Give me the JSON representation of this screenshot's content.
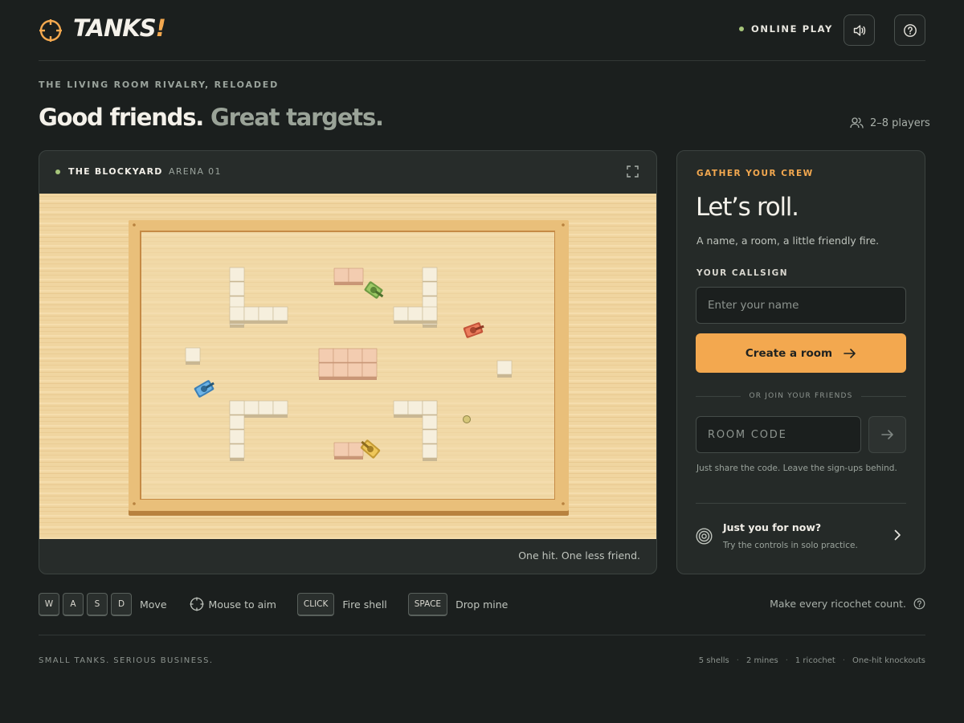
{
  "header": {
    "logo_text": "TANKS",
    "logo_bang": "!",
    "status_label": "ONLINE PLAY",
    "status_color": "#a6c57a",
    "sound_icon": "speaker-icon",
    "help_icon": "help-circle-icon"
  },
  "hero": {
    "eyebrow": "THE LIVING ROOM RIVALRY, RELOADED",
    "headline_main": "Good friends.",
    "headline_muted": "Great targets.",
    "players": "2–8 players"
  },
  "arena": {
    "name": "THE BLOCKYARD",
    "subtitle": "ARENA 01",
    "tagline": "One hit. One less friend.",
    "tanks": [
      {
        "team": "green",
        "color": "#8fbf5a"
      },
      {
        "team": "red",
        "color": "#e06b4a"
      },
      {
        "team": "blue",
        "color": "#4f9bd4"
      },
      {
        "team": "yellow",
        "color": "#e3b84b"
      }
    ]
  },
  "panel": {
    "eyebrow": "GATHER YOUR CREW",
    "title": "Let’s roll.",
    "subtitle": "A name, a room, a little friendly fire.",
    "callsign_label": "YOUR CALLSIGN",
    "name_placeholder": "Enter your name",
    "create_label": "Create a room",
    "divider_label": "OR JOIN YOUR FRIENDS",
    "code_placeholder": "ROOM CODE",
    "hint": "Just share the code. Leave the sign-ups behind.",
    "solo_title": "Just you for now?",
    "solo_sub": "Try the controls in solo practice.",
    "accent": "#f3a84f"
  },
  "controls": {
    "move_keys": [
      "W",
      "A",
      "S",
      "D"
    ],
    "move_label": "Move",
    "aim_label": "Mouse to aim",
    "fire_key": "CLICK",
    "fire_label": "Fire shell",
    "mine_key": "SPACE",
    "mine_label": "Drop mine",
    "ricochet_text": "Make every ricochet count."
  },
  "footer": {
    "left": "SMALL TANKS. SERIOUS BUSINESS.",
    "stats": [
      "5 shells",
      "2 mines",
      "1 ricochet",
      "One-hit knockouts"
    ],
    "separator": "·"
  }
}
